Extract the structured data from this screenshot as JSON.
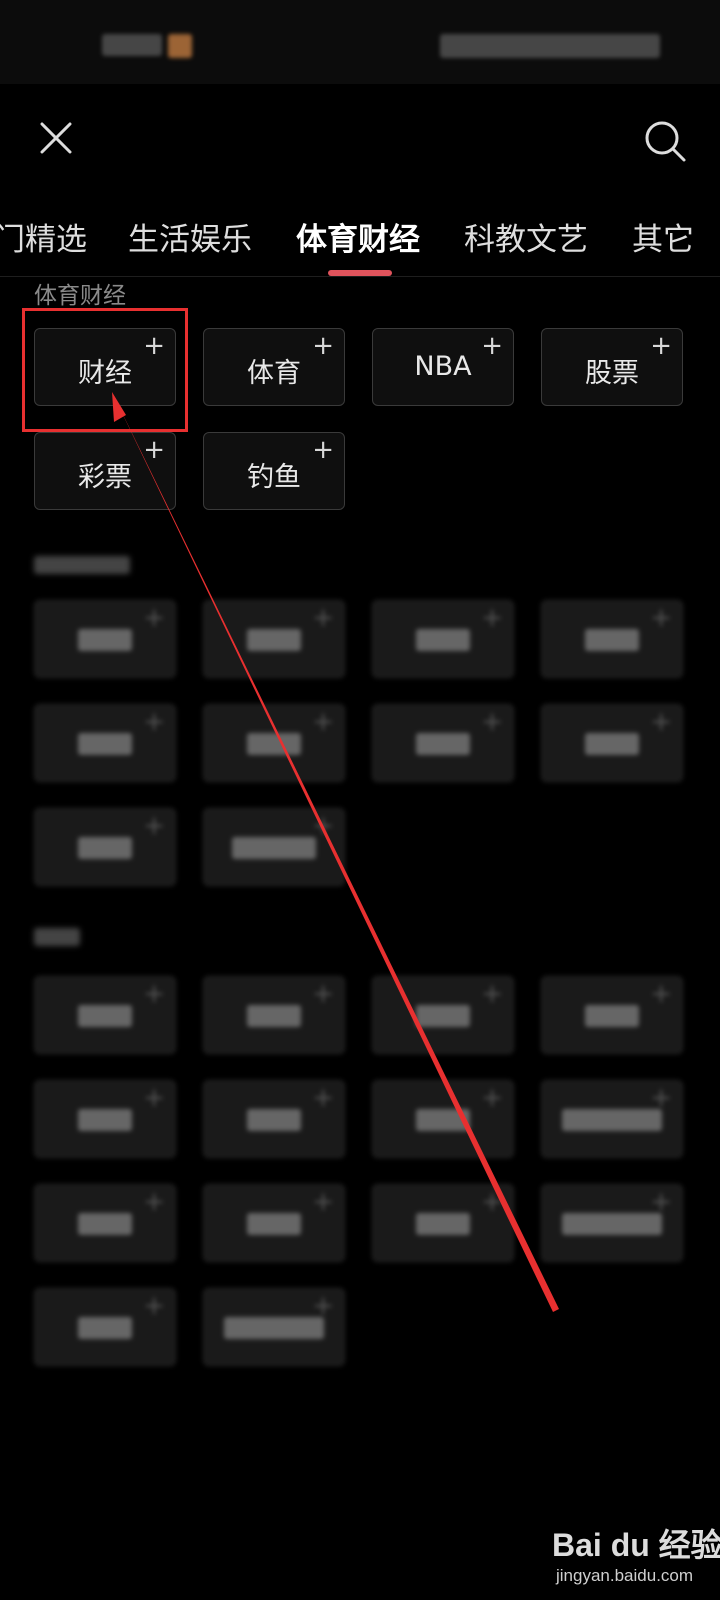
{
  "header": {
    "tabs": [
      {
        "label": "门精选",
        "active": false
      },
      {
        "label": "生活娱乐",
        "active": false
      },
      {
        "label": "体育财经",
        "active": true
      },
      {
        "label": "科教文艺",
        "active": false
      },
      {
        "label": "其它",
        "active": false
      }
    ]
  },
  "section_sports_finance": {
    "title": "体育财经",
    "chips": [
      {
        "label": "财经",
        "action": "+"
      },
      {
        "label": "体育",
        "action": "+"
      },
      {
        "label": "NBA",
        "action": "+"
      },
      {
        "label": "股票",
        "action": "+"
      },
      {
        "label": "彩票",
        "action": "+"
      },
      {
        "label": "钓鱼",
        "action": "+"
      }
    ]
  },
  "watermark": {
    "brand": "Bai du 经验",
    "url": "jingyan.baidu.com"
  },
  "colors": {
    "background": "#000000",
    "accent": "#e0535c",
    "annotation": "#e83030"
  },
  "icons": {
    "close": "close-icon",
    "search": "search-icon"
  }
}
